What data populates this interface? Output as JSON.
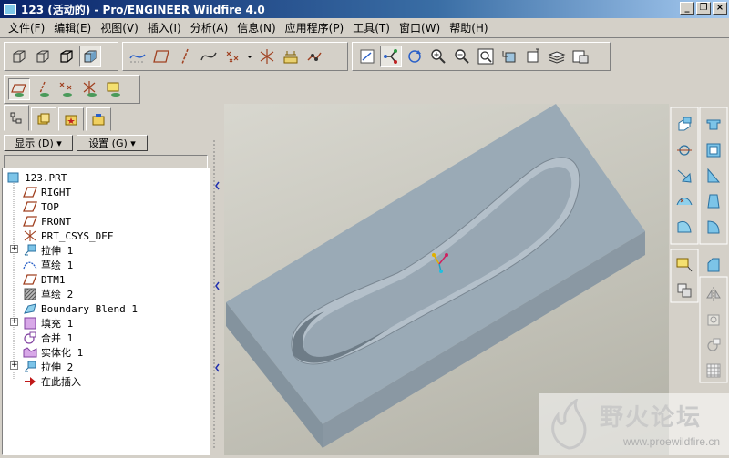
{
  "window": {
    "title": "123 (活动的) - Pro/ENGINEER Wildfire 4.0",
    "controls": [
      "_",
      "❐",
      "×"
    ]
  },
  "menu": [
    "文件(F)",
    "编辑(E)",
    "视图(V)",
    "插入(I)",
    "分析(A)",
    "信息(N)",
    "应用程序(P)",
    "工具(T)",
    "窗口(W)",
    "帮助(H)"
  ],
  "navigator": {
    "show_label": "显示 (D) ▾",
    "settings_label": "设置 (G) ▾",
    "tree": [
      {
        "label": "123.PRT",
        "icon": "part-icon",
        "indent": 0,
        "expandable": false
      },
      {
        "label": "RIGHT",
        "icon": "datum-plane-icon",
        "indent": 1,
        "expandable": false
      },
      {
        "label": "TOP",
        "icon": "datum-plane-icon",
        "indent": 1,
        "expandable": false
      },
      {
        "label": "FRONT",
        "icon": "datum-plane-icon",
        "indent": 1,
        "expandable": false
      },
      {
        "label": "PRT_CSYS_DEF",
        "icon": "csys-icon",
        "indent": 1,
        "expandable": false
      },
      {
        "label": "拉伸 1",
        "icon": "extrude-icon",
        "indent": 1,
        "expandable": true
      },
      {
        "label": "草绘 1",
        "icon": "sketch-icon",
        "indent": 1,
        "expandable": false
      },
      {
        "label": "DTM1",
        "icon": "datum-plane-icon",
        "indent": 1,
        "expandable": false
      },
      {
        "label": "草绘 2",
        "icon": "hatched-sketch-icon",
        "indent": 1,
        "expandable": false
      },
      {
        "label": "Boundary Blend 1",
        "icon": "boundary-blend-icon",
        "indent": 1,
        "expandable": false
      },
      {
        "label": "填充 1",
        "icon": "fill-icon",
        "indent": 1,
        "expandable": true
      },
      {
        "label": "合并 1",
        "icon": "merge-icon",
        "indent": 1,
        "expandable": false
      },
      {
        "label": "实体化 1",
        "icon": "solidify-icon",
        "indent": 1,
        "expandable": false
      },
      {
        "label": "拉伸 2",
        "icon": "extrude-icon",
        "indent": 1,
        "expandable": true
      },
      {
        "label": "在此插入",
        "icon": "insert-here-icon",
        "indent": 1,
        "expandable": false
      }
    ]
  },
  "watermark": {
    "brand": "野火论坛",
    "url": "www.proewildfire.cn"
  }
}
